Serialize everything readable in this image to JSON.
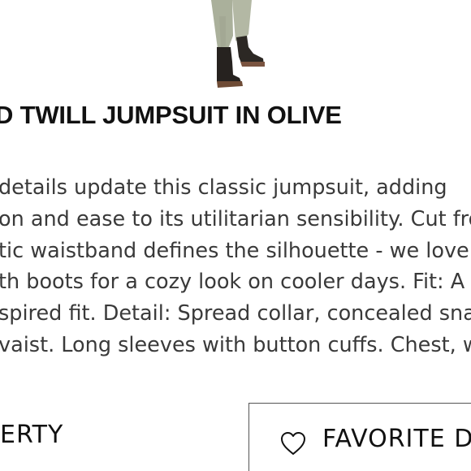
{
  "product": {
    "title": "D TWILL JUMPSUIT IN OLIVE",
    "description_lines": [
      "details update this classic jumpsuit, adding",
      "on and ease to its utilitarian sensibility. Cut fro",
      "tic waistband defines the silhouette - we love",
      "th boots for a cozy look on cooler days. Fit: A",
      "spired fit. Detail: Spread collar, concealed sna",
      "vaist. Long sleeves with button cuffs. Chest, w"
    ]
  },
  "actions": {
    "left_button_label": "ERTY",
    "favorite_button_label": "FAVORITE DE",
    "favorite_icon": "heart-icon"
  },
  "colors": {
    "pants": "#a8ad98",
    "boots": "#2a2622",
    "text": "#111111"
  }
}
